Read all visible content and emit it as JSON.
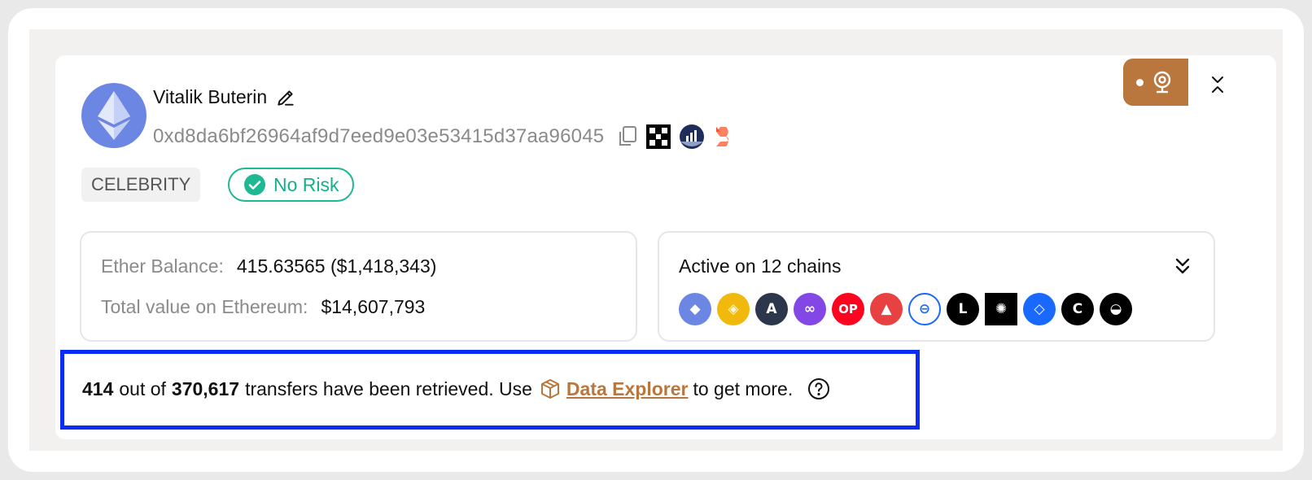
{
  "profile": {
    "name": "Vitalik Buterin",
    "address": "0xd8da6bf26964af9d7eed9e03e53415d37aa96045",
    "avatar_icon": "ethereum-icon",
    "tag_celebrity": "CELEBRITY",
    "tag_risk": "No Risk"
  },
  "balances": {
    "ether_label": "Ether Balance:",
    "ether_value": "415.63565 ($1,418,343)",
    "total_label": "Total value on Ethereum:",
    "total_value": "$14,607,793"
  },
  "chains": {
    "title": "Active on 12 chains",
    "items": [
      {
        "name": "ethereum-icon",
        "color": "#6c86e3",
        "glyph": "◆"
      },
      {
        "name": "bnb-chain-icon",
        "color": "#f0b90b",
        "glyph": "◈"
      },
      {
        "name": "arbitrum-icon",
        "color": "#2d374b",
        "glyph": "A"
      },
      {
        "name": "polygon-icon",
        "color": "#8247e5",
        "glyph": "∞"
      },
      {
        "name": "optimism-icon",
        "color": "#ff0420",
        "glyph": "OP"
      },
      {
        "name": "avalanche-icon",
        "color": "#e84142",
        "glyph": "▲"
      },
      {
        "name": "linea-icon",
        "color": "#ffffff",
        "glyph": "⊖"
      },
      {
        "name": "lens-icon",
        "color": "#000000",
        "glyph": "L"
      },
      {
        "name": "zksync-icon",
        "color": "#000000",
        "glyph": "✺"
      },
      {
        "name": "fantom-icon",
        "color": "#1969ff",
        "glyph": "◇"
      },
      {
        "name": "celo-icon",
        "color": "#000000",
        "glyph": "C"
      },
      {
        "name": "solana-icon",
        "color": "#000000",
        "glyph": "◒"
      }
    ]
  },
  "notice": {
    "retrieved": "414",
    "text_out_of": "out of",
    "total": "370,617",
    "text_mid": "transfers have been retrieved. Use",
    "link_label": "Data Explorer",
    "text_end": "to get more."
  },
  "colors": {
    "accent": "#b9773d",
    "risk_green": "#1fb894",
    "highlight_blue": "#0a2cf5"
  }
}
